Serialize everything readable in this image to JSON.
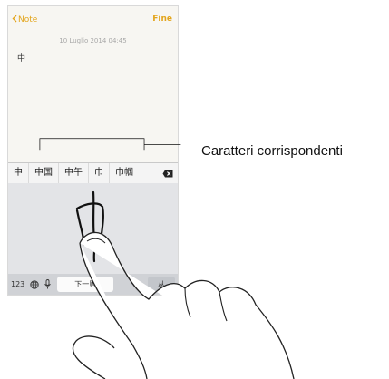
{
  "nav": {
    "back_label": "Note",
    "done_label": "Fine"
  },
  "note": {
    "date": "10 Luglio 2014 04:45",
    "body": "中"
  },
  "candidates": [
    "中",
    "中国",
    "中午",
    "巾",
    "巾帼"
  ],
  "keyboard": {
    "numbers_label": "123",
    "space_label": "下一则",
    "right_label": "从"
  },
  "callout": {
    "label": "Caratteri corrispondenti"
  },
  "colors": {
    "accent": "#e3a51c",
    "background": "#f7f6f2"
  }
}
